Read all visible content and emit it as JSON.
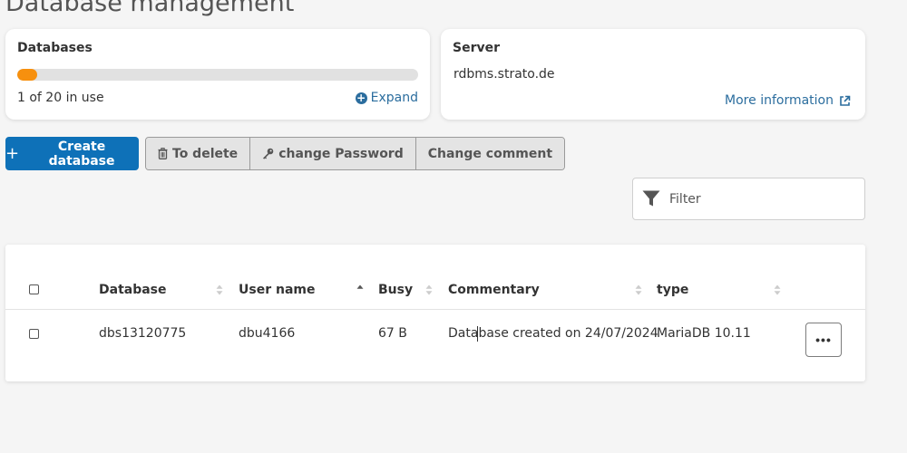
{
  "page": {
    "title": "Database management"
  },
  "databases_card": {
    "title": "Databases",
    "usage_text": "1 of 20 in use",
    "usage_fraction": 0.05,
    "expand_label": "Expand"
  },
  "server_card": {
    "title": "Server",
    "host": "rdbms.strato.de",
    "more_info_label": "More information"
  },
  "toolbar": {
    "create_label": "Create database",
    "delete_label": "To delete",
    "password_label": "change Password",
    "comment_label": "Change comment"
  },
  "filter": {
    "placeholder": "Filter"
  },
  "table": {
    "headers": {
      "database": "Database",
      "user": "User name",
      "busy": "Busy",
      "commentary": "Commentary",
      "type": "type"
    },
    "rows": [
      {
        "database": "dbs13120775",
        "user": "dbu4166",
        "busy": "67 B",
        "commentary_before": "Data",
        "commentary_after": "base created on 24/07/2024",
        "type": "MariaDB 10.11"
      }
    ],
    "row_menu_label": "•••"
  },
  "colors": {
    "primary": "#0e71b8",
    "progress": "#f7900e",
    "link": "#2b6d9e"
  },
  "icons": {
    "expand": "plus-circle-icon",
    "more_info": "external-link-icon",
    "delete": "trash-icon",
    "password": "key-icon",
    "filter": "funnel-icon"
  }
}
